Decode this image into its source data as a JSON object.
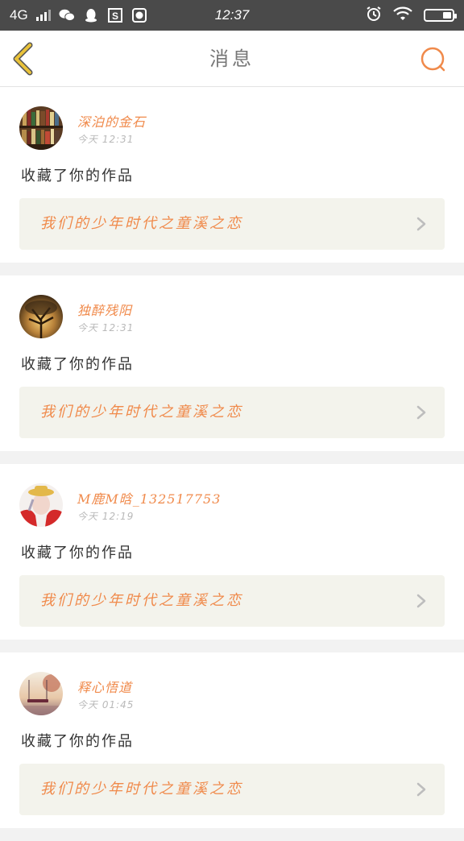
{
  "statusbar": {
    "network": "4G",
    "time": "12:37"
  },
  "navbar": {
    "title": "消息"
  },
  "colors": {
    "accent": "#f08a4b",
    "back_icon": "#e9c23a",
    "card_button_bg": "#f3f3ec"
  },
  "messages": [
    {
      "username": "深泊的金石",
      "time": "今天  12:31",
      "action": "收藏了你的作品",
      "work_title": "我们的少年时代之童溪之恋"
    },
    {
      "username": "独醉残阳",
      "time": "今天  12:31",
      "action": "收藏了你的作品",
      "work_title": "我们的少年时代之童溪之恋"
    },
    {
      "username": "M鹿M晗_132517753",
      "time": "今天  12:19",
      "action": "收藏了你的作品",
      "work_title": "我们的少年时代之童溪之恋"
    },
    {
      "username": "释心悟道",
      "time": "今天  01:45",
      "action": "收藏了你的作品",
      "work_title": "我们的少年时代之童溪之恋"
    }
  ]
}
